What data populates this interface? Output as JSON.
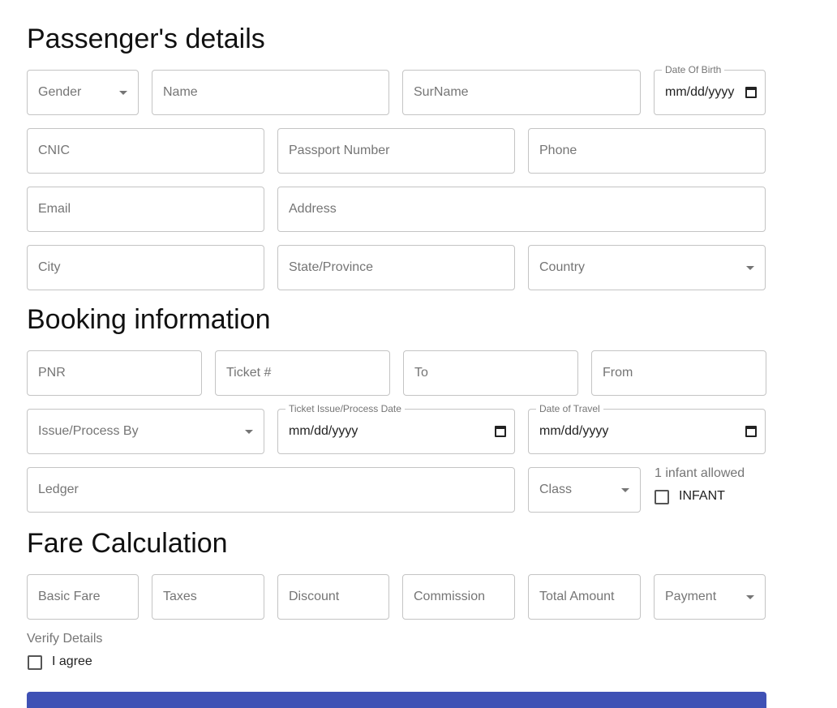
{
  "passenger": {
    "heading": "Passenger's details",
    "gender": "Gender",
    "name": "Name",
    "surname": "SurName",
    "dob_label": "Date Of Birth",
    "dob_value": "mm/dd/yyyy",
    "cnic": "CNIC",
    "passport": "Passport Number",
    "phone": "Phone",
    "email": "Email",
    "address": "Address",
    "city": "City",
    "state": "State/Province",
    "country": "Country"
  },
  "booking": {
    "heading": "Booking information",
    "pnr": "PNR",
    "ticket": "Ticket #",
    "to": "To",
    "from": "From",
    "issue_by": "Issue/Process By",
    "issue_date_label": "Ticket Issue/Process Date",
    "issue_date_value": "mm/dd/yyyy",
    "travel_date_label": "Date of Travel",
    "travel_date_value": "mm/dd/yyyy",
    "ledger": "Ledger",
    "class": "Class",
    "infant_note": "1 infant allowed",
    "infant_label": "INFANT"
  },
  "fare": {
    "heading": "Fare Calculation",
    "basic_fare": "Basic Fare",
    "taxes": "Taxes",
    "discount": "Discount",
    "commission": "Commission",
    "total_amount": "Total Amount",
    "payment": "Payment",
    "verify_label": "Verify Details",
    "agree_label": "I agree"
  },
  "colors": {
    "primary": "#3f51b5",
    "border": "#c4c4c4",
    "placeholder": "#757575"
  }
}
